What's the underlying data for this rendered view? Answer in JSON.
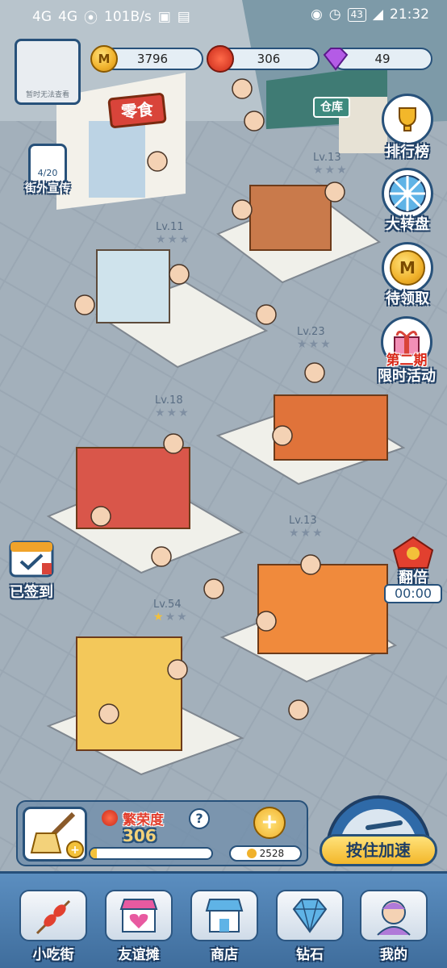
{
  "status_bar": {
    "left": [
      "4G",
      "4G",
      "101B/s"
    ],
    "battery": "43",
    "time": "21:32"
  },
  "avatar": {
    "caption": "暂时无法查看"
  },
  "currencies": [
    {
      "icon": "gold-coin-icon",
      "value": "3796"
    },
    {
      "icon": "lantern-icon",
      "value": "306"
    },
    {
      "icon": "diamond-icon",
      "value": "49"
    }
  ],
  "flyer": {
    "progress": "4/20",
    "label": "街外宣传"
  },
  "shop_signs": {
    "snack_shop": "零食",
    "warehouse": "仓库"
  },
  "side_menu": [
    {
      "label": "排行榜",
      "icon": "trophy-icon"
    },
    {
      "label": "大转盘",
      "icon": "wheel-icon"
    },
    {
      "label": "待领取",
      "icon": "coin-icon"
    },
    {
      "label": "限时活动",
      "badge": "第二期",
      "icon": "gift-icon"
    }
  ],
  "left_menu": {
    "signin": "已签到"
  },
  "double": {
    "label": "翻倍",
    "timer": "00:00"
  },
  "stalls": [
    {
      "level": "Lv.11",
      "stars": 0
    },
    {
      "level": "Lv.13",
      "stars": 0
    },
    {
      "level": "Lv.23",
      "stars": 0
    },
    {
      "level": "Lv.18",
      "stars": 0
    },
    {
      "level": "Lv.13",
      "stars": 0
    },
    {
      "level": "Lv.54",
      "stars": 1
    }
  ],
  "prosperity": {
    "label": "繁荣度",
    "value": "306",
    "help": "?",
    "progress": 0.05,
    "coins": "2528"
  },
  "speedup": {
    "label": "按住加速"
  },
  "bottom_nav": [
    {
      "label": "小吃街",
      "icon": "skewer-icon"
    },
    {
      "label": "友谊摊",
      "icon": "stall-heart-icon"
    },
    {
      "label": "商店",
      "icon": "shop-icon"
    },
    {
      "label": "钻石",
      "icon": "diamond-icon"
    },
    {
      "label": "我的",
      "icon": "profile-icon"
    }
  ]
}
